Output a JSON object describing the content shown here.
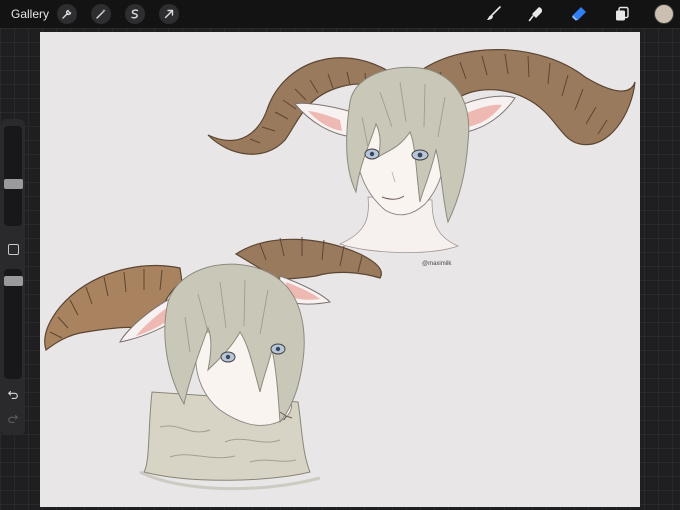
{
  "toolbar": {
    "gallery_label": "Gallery",
    "left_tools": [
      {
        "name": "wrench-icon"
      },
      {
        "name": "magic-wand-icon"
      },
      {
        "name": "selection-icon"
      },
      {
        "name": "transform-arrow-icon"
      }
    ],
    "right_tools": [
      {
        "name": "brush-icon"
      },
      {
        "name": "smudge-icon"
      },
      {
        "name": "eraser-icon"
      },
      {
        "name": "layers-icon"
      }
    ],
    "current_color": "#cbbfb1",
    "accent_color": "#2f7ff5"
  },
  "canvas": {
    "background": "#e9e6e8",
    "watermark": "@maximilk"
  },
  "sidebar": {
    "icons": [
      "square-modify-icon",
      "undo-icon",
      "redo-icon"
    ]
  }
}
